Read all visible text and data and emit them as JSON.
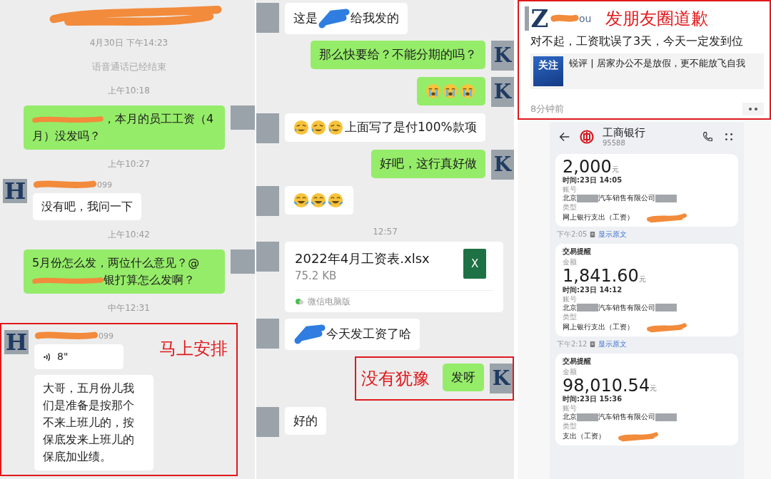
{
  "chats": [
    {
      "items": [
        {
          "kind": "redacted_header"
        },
        {
          "kind": "time",
          "text": "4月30日 下午14:23"
        },
        {
          "kind": "system",
          "text": "语音通话已经结束"
        },
        {
          "kind": "time",
          "text": "上午10:18"
        },
        {
          "kind": "outgoing",
          "bubbles": [
            {
              "kind": "text",
              "parts": [
                {
                  "kind": "scribble",
                  "color": "#f28b3b"
                },
                {
                  "kind": "text",
                  "text": "，本月的员工工资（4月）没发吗？"
                }
              ]
            }
          ]
        },
        {
          "kind": "time",
          "text": "上午10:27"
        },
        {
          "kind": "incoming",
          "avatar": "H",
          "sender_suffix": "099",
          "bubbles": [
            {
              "kind": "text",
              "parts": [
                {
                  "kind": "text",
                  "text": "没有吧，我问一下"
                }
              ]
            }
          ]
        },
        {
          "kind": "time",
          "text": "上午10:42"
        },
        {
          "kind": "outgoing",
          "bubbles": [
            {
              "kind": "text",
              "parts": [
                {
                  "kind": "text",
                  "text": "5月份怎么发，两位什么意见？@"
                },
                {
                  "kind": "scribble",
                  "color": "#f28b3b"
                },
                {
                  "kind": "text",
                  "text": "银打算怎么发啊？"
                }
              ]
            }
          ]
        },
        {
          "kind": "time",
          "text": "中午12:31"
        },
        {
          "kind": "incoming",
          "avatar": "H",
          "sender_suffix": "099",
          "annotation": "马上安排",
          "bubbles": [
            {
              "kind": "voice",
              "duration": "8\""
            },
            {
              "kind": "text",
              "parts": [
                {
                  "kind": "text",
                  "text": "大哥，五月份儿我们是准备是按那个不来上班儿的，按保底发来上班儿的保底加业绩。"
                }
              ]
            }
          ]
        }
      ]
    },
    {
      "items": [
        {
          "kind": "incoming",
          "bubbles": [
            {
              "kind": "text",
              "parts": [
                {
                  "kind": "text",
                  "text": "这是"
                },
                {
                  "kind": "blot",
                  "color": "#2f7de1"
                },
                {
                  "kind": "text",
                  "text": "给我发的"
                }
              ]
            }
          ]
        },
        {
          "kind": "outgoing",
          "avatar": "K",
          "bubbles": [
            {
              "kind": "text",
              "parts": [
                {
                  "kind": "text",
                  "text": "那么快要给？不能分期的吗？"
                }
              ]
            }
          ]
        },
        {
          "kind": "outgoing",
          "avatar": "K",
          "bubbles": [
            {
              "kind": "text",
              "parts": [
                {
                  "kind": "cry"
                },
                {
                  "kind": "cry"
                },
                {
                  "kind": "cry"
                }
              ]
            }
          ]
        },
        {
          "kind": "incoming",
          "bubbles": [
            {
              "kind": "text",
              "parts": [
                {
                  "kind": "sweat"
                },
                {
                  "kind": "sweat"
                },
                {
                  "kind": "sweat"
                },
                {
                  "kind": "text",
                  "text": "上面写了是付100%款项"
                }
              ]
            }
          ]
        },
        {
          "kind": "outgoing",
          "avatar": "K",
          "bubbles": [
            {
              "kind": "text",
              "parts": [
                {
                  "kind": "text",
                  "text": "好吧，这行真好做"
                }
              ]
            }
          ]
        },
        {
          "kind": "incoming",
          "bubbles": [
            {
              "kind": "text",
              "parts": [
                {
                  "kind": "laugh"
                },
                {
                  "kind": "laugh"
                },
                {
                  "kind": "laugh"
                }
              ]
            }
          ]
        },
        {
          "kind": "time",
          "text": "12:57"
        },
        {
          "kind": "incoming",
          "bubbles": [
            {
              "kind": "file",
              "filename": "2022年4月工资表.xlsx",
              "size": "75.2 KB",
              "icon_letter": "X",
              "source": "微信电脑版"
            }
          ]
        },
        {
          "kind": "incoming",
          "bubbles": [
            {
              "kind": "text",
              "parts": [
                {
                  "kind": "blot",
                  "color": "#2f7de1"
                },
                {
                  "kind": "text",
                  "text": "今天发工资了哈"
                }
              ]
            }
          ]
        },
        {
          "kind": "outgoing",
          "avatar": "K",
          "annotation": "没有犹豫",
          "bubbles": [
            {
              "kind": "text",
              "parts": [
                {
                  "kind": "text",
                  "text": "发呀"
                }
              ]
            }
          ]
        },
        {
          "kind": "incoming",
          "bubbles": [
            {
              "kind": "text",
              "parts": [
                {
                  "kind": "text",
                  "text": "好的"
                }
              ]
            }
          ]
        }
      ]
    }
  ],
  "moment": {
    "avatar": "Z",
    "name_suffix": "ou",
    "annotation": "发朋友圈道歉",
    "text": "对不起，工资耽误了3天，今天一定发到位",
    "link": {
      "thumb_text": "关注",
      "title": "锐评 | 居家办公不是放假，更不能放飞自我"
    },
    "time": "8分钟前"
  },
  "bank": {
    "title": "工商银行",
    "number": "95588",
    "cards": [
      {
        "amount": "2,000",
        "unit": "元",
        "time": "时间:23日 14:05",
        "account_label": "账号",
        "account_parts": [
          "北京",
          "汽车销售有限公司"
        ],
        "type_label": "类型",
        "type": "网上银行支出（工资）",
        "footer_time": "下午2:05",
        "footer_link": "显示原文"
      },
      {
        "heading": "交易提醒",
        "amount_label": "金额",
        "amount": "1,841.60",
        "unit": "元",
        "time": "时间:23日 14:12",
        "account_label": "账号",
        "account_parts": [
          "北京",
          "汽车销售有限公司"
        ],
        "type_label": "类型",
        "type": "网上银行支出（工资）",
        "footer_time": "下午2:12",
        "footer_link": "显示原文"
      },
      {
        "heading": "交易提醒",
        "amount_label": "金额",
        "amount": "98,010.54",
        "unit": "元",
        "time": "时间:23日 15:36",
        "account_label": "账号",
        "account_parts": [
          "北京",
          "汽车销售有限公司"
        ],
        "type_label": "类型",
        "type": "支出（工资）"
      }
    ]
  }
}
